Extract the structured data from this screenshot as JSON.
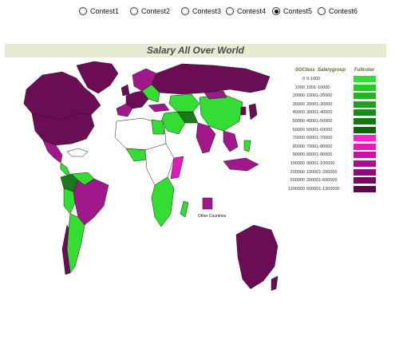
{
  "contests": [
    {
      "label": "Contest1",
      "selected": false
    },
    {
      "label": "Contest2",
      "selected": false
    },
    {
      "label": "Contest3",
      "selected": false
    },
    {
      "label": "Contest4",
      "selected": false
    },
    {
      "label": "Contest5",
      "selected": true
    },
    {
      "label": "Contest6",
      "selected": false
    }
  ],
  "title": "Salary All Over World",
  "legend": {
    "headers": [
      "SGClass",
      "Salarygroup",
      "Fullcolor"
    ],
    "rows": [
      {
        "sgclass": "0",
        "group": "0-1000",
        "color": "#33dd33"
      },
      {
        "sgclass": "1000",
        "group": "1001-10000",
        "color": "#22cc22"
      },
      {
        "sgclass": "20000",
        "group": "10001-20000",
        "color": "#1cb81c"
      },
      {
        "sgclass": "30000",
        "group": "20001-30000",
        "color": "#18a318"
      },
      {
        "sgclass": "40000",
        "group": "30001-40000",
        "color": "#148e14"
      },
      {
        "sgclass": "50000",
        "group": "40001-50000",
        "color": "#107a10"
      },
      {
        "sgclass": "60000",
        "group": "50001-60000",
        "color": "#0b640b"
      },
      {
        "sgclass": "70000",
        "group": "60001-70000",
        "color": "#ff22cc"
      },
      {
        "sgclass": "80000",
        "group": "70001-80000",
        "color": "#e51aba"
      },
      {
        "sgclass": "90000",
        "group": "80001-90000",
        "color": "#c914a3"
      },
      {
        "sgclass": "100000",
        "group": "90001-100000",
        "color": "#a80f8a"
      },
      {
        "sgclass": "200000",
        "group": "100001-200000",
        "color": "#8c0c74"
      },
      {
        "sgclass": "500000",
        "group": "200001-600000",
        "color": "#740a60"
      },
      {
        "sgclass": "1300000",
        "group": "600001-1300000",
        "color": "#5a0848"
      }
    ]
  },
  "map": {
    "other_countries_label": "Other Countries",
    "colors": {
      "purple": "#6b0d55",
      "magenta": "#a0188a",
      "pink": "#e01bb8",
      "green": "#33dd33",
      "dark_green": "#1a7a1a",
      "white": "#ffffff"
    }
  }
}
